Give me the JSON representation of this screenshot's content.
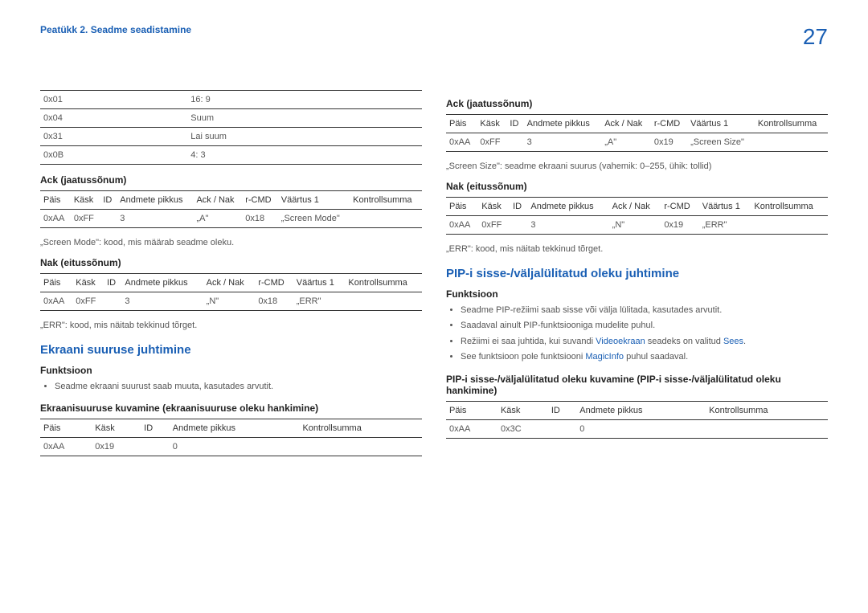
{
  "header": {
    "chapter": "Peatükk 2. Seadme seadistamine",
    "page": "27"
  },
  "left": {
    "modesTable": {
      "rows": [
        [
          "0x01",
          "16: 9"
        ],
        [
          "0x04",
          "Suum"
        ],
        [
          "0x31",
          "Lai suum"
        ],
        [
          "0x0B",
          "4: 3"
        ]
      ]
    },
    "ack1": {
      "title": "Ack (jaatussõnum)",
      "headers": [
        "Päis",
        "Käsk",
        "ID",
        "Andmete pikkus",
        "Ack / Nak",
        "r-CMD",
        "Väärtus 1",
        "Kontrollsumma"
      ],
      "row": [
        "0xAA",
        "0xFF",
        "",
        "3",
        "„A\"",
        "0x18",
        "„Screen Mode\"",
        ""
      ]
    },
    "ack1_note": "„Screen Mode\": kood, mis määrab seadme oleku.",
    "nak1": {
      "title": "Nak (eitussõnum)",
      "headers": [
        "Päis",
        "Käsk",
        "ID",
        "Andmete pikkus",
        "Ack / Nak",
        "r-CMD",
        "Väärtus 1",
        "Kontrollsumma"
      ],
      "row": [
        "0xAA",
        "0xFF",
        "",
        "3",
        "„N\"",
        "0x18",
        "„ERR\"",
        ""
      ]
    },
    "nak1_note": "„ERR\": kood, mis näitab tekkinud tõrget.",
    "section1": {
      "title": "Ekraani suuruse juhtimine",
      "functionTitle": "Funktsioon",
      "functionBullets": [
        "Seadme ekraani suurust saab muuta, kasutades arvutit."
      ],
      "sub1": "Ekraanisuuruse kuvamine (ekraanisuuruse oleku hankimine)",
      "tbl": {
        "headers": [
          "Päis",
          "Käsk",
          "ID",
          "Andmete pikkus",
          "Kontrollsumma"
        ],
        "row": [
          "0xAA",
          "0x19",
          "",
          "0",
          ""
        ]
      }
    }
  },
  "right": {
    "ack2": {
      "title": "Ack (jaatussõnum)",
      "headers": [
        "Päis",
        "Käsk",
        "ID",
        "Andmete pikkus",
        "Ack / Nak",
        "r-CMD",
        "Väärtus 1",
        "Kontrollsumma"
      ],
      "row": [
        "0xAA",
        "0xFF",
        "",
        "3",
        "„A\"",
        "0x19",
        "„Screen Size\"",
        ""
      ]
    },
    "ack2_note": "„Screen Size\": seadme ekraani suurus (vahemik: 0–255, ühik: tollid)",
    "nak2": {
      "title": "Nak (eitussõnum)",
      "headers": [
        "Päis",
        "Käsk",
        "ID",
        "Andmete pikkus",
        "Ack / Nak",
        "r-CMD",
        "Väärtus 1",
        "Kontrollsumma"
      ],
      "row": [
        "0xAA",
        "0xFF",
        "",
        "3",
        "„N\"",
        "0x19",
        "„ERR\"",
        ""
      ]
    },
    "nak2_note": "„ERR\": kood, mis näitab tekkinud tõrget.",
    "section2": {
      "title": "PIP-i sisse-/väljalülitatud oleku juhtimine",
      "functionTitle": "Funktsioon",
      "functionBullets": [
        "Seadme PIP-režiimi saab sisse või välja lülitada, kasutades arvutit.",
        "Saadaval ainult PIP-funktsiooniga mudelite puhul.",
        "Režiimi ei saa juhtida, kui suvandi",
        "See funktsioon pole funktsiooni"
      ],
      "key1": "Videoekraan",
      "key1_after": " seadeks on valitud ",
      "key2": "Sees",
      "key3": "MagicInfo",
      "key3_after": " puhul saadaval.",
      "sub1": "PIP-i sisse-/väljalülitatud oleku kuvamine (PIP-i sisse-/väljalülitatud oleku hankimine)",
      "tbl": {
        "headers": [
          "Päis",
          "Käsk",
          "ID",
          "Andmete pikkus",
          "Kontrollsumma"
        ],
        "row": [
          "0xAA",
          "0x3C",
          "",
          "0",
          ""
        ]
      }
    }
  }
}
